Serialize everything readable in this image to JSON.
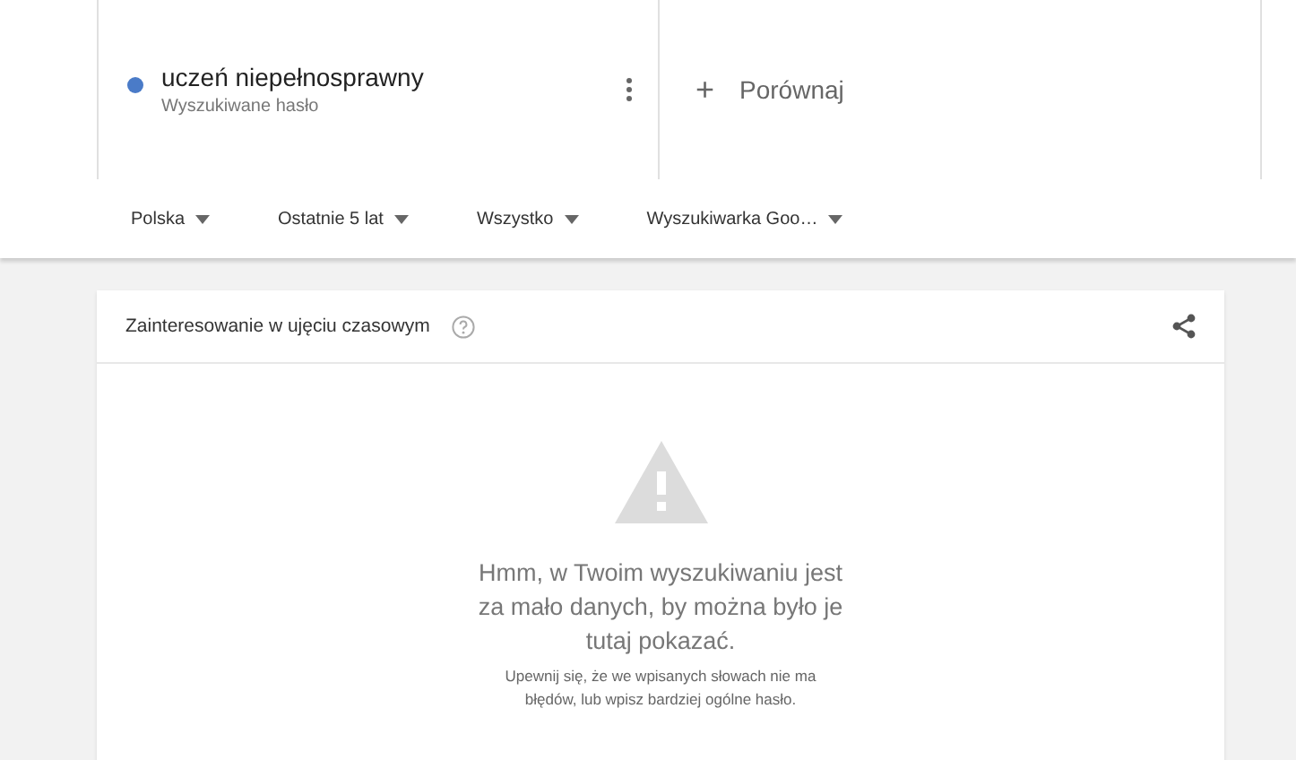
{
  "search_term": {
    "term": "uczeń niepełnosprawny",
    "subtitle": "Wyszukiwane hasło",
    "color": "#4a7bc8"
  },
  "compare": {
    "plus": "+",
    "label": "Porównaj"
  },
  "filters": [
    {
      "label": "Polska"
    },
    {
      "label": "Ostatnie 5 lat"
    },
    {
      "label": "Wszystko"
    },
    {
      "label": "Wyszukiwarka Goo…"
    }
  ],
  "card": {
    "title": "Zainteresowanie w ujęciu czasowym",
    "message": "Hmm, w Twoim wyszukiwaniu jest za mało danych, by można było je tutaj pokazać.",
    "hint": "Upewnij się, że we wpisanych słowach nie ma błędów, lub wpisz bardziej ogólne hasło."
  }
}
